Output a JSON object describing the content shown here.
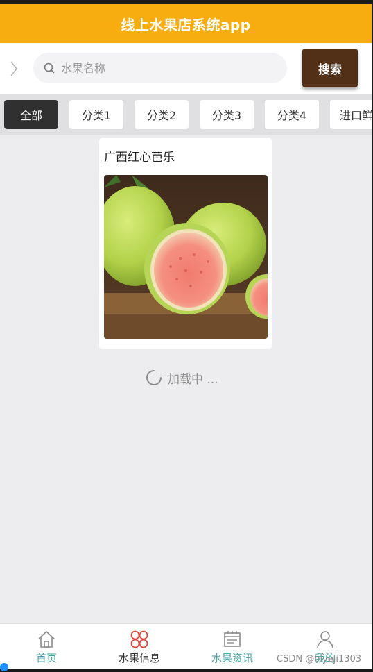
{
  "header": {
    "title": "线上水果店系统app"
  },
  "search": {
    "placeholder": "水果名称",
    "button_label": "搜索"
  },
  "categories": [
    {
      "label": "全部",
      "active": true
    },
    {
      "label": "分类1",
      "active": false
    },
    {
      "label": "分类2",
      "active": false
    },
    {
      "label": "分类3",
      "active": false
    },
    {
      "label": "分类4",
      "active": false
    },
    {
      "label": "进口鲜",
      "active": false
    }
  ],
  "products": [
    {
      "name": "广西红心芭乐",
      "image": "guava-photo"
    }
  ],
  "loading": {
    "text": "加载中 ..."
  },
  "tabbar": {
    "items": [
      {
        "label": "首页",
        "icon": "home-icon",
        "color": "#4aa3a3"
      },
      {
        "label": "水果信息",
        "icon": "clover-grid-icon",
        "color": "#333333",
        "icon_color": "#e0483c"
      },
      {
        "label": "水果资讯",
        "icon": "news-icon",
        "color": "#4aa3a3"
      },
      {
        "label": "我的",
        "icon": "user-icon",
        "color": "#4aa3a3"
      }
    ]
  },
  "watermark": "CSDN @biyeji1303",
  "colors": {
    "header": "#f7ad0f",
    "search_button": "#523018",
    "active_tab": "#303030"
  }
}
